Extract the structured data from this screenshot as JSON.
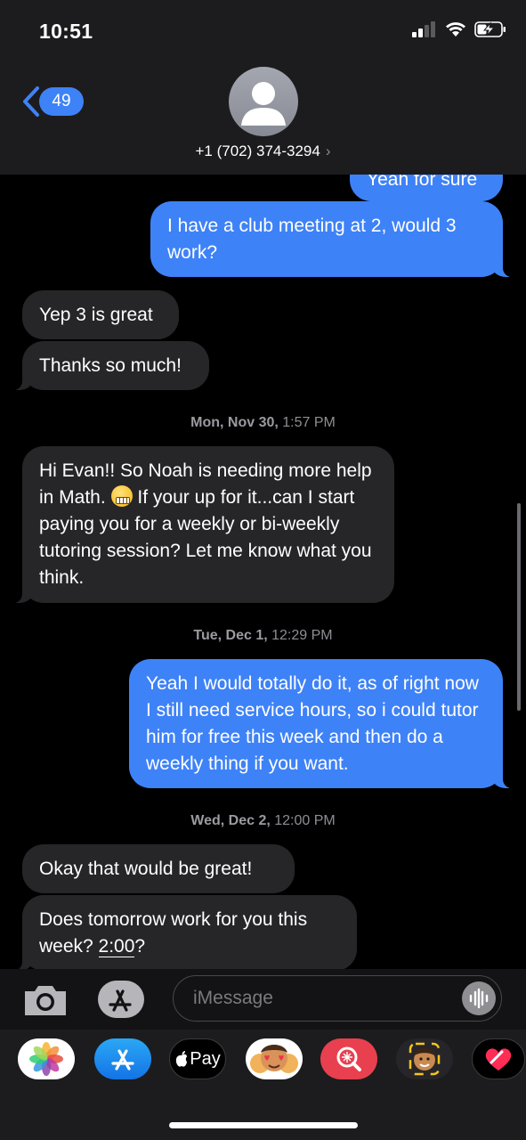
{
  "status_bar": {
    "time": "10:51"
  },
  "header": {
    "back_count": "49",
    "contact": "+1 (702) 374-3294",
    "contact_chevron": "›"
  },
  "messages": [
    {
      "dir": "out",
      "text": "Yeah for sure"
    },
    {
      "dir": "out",
      "text": "I have a club meeting at 2, would 3 work?"
    },
    {
      "dir": "in",
      "text": "Yep 3 is great"
    },
    {
      "dir": "in",
      "text": "Thanks so much!"
    },
    {
      "type": "timestamp",
      "day": "Mon, Nov 30,",
      "time": "1:57 PM"
    },
    {
      "dir": "in",
      "text_a": "Hi Evan!! So Noah is needing more help in Math.",
      "emoji": "grimacing-face",
      "text_b": "If your up for it...can I start paying you for a weekly or bi-weekly tutoring session? Let me know what you think."
    },
    {
      "type": "timestamp",
      "day": "Tue, Dec 1,",
      "time": "12:29 PM"
    },
    {
      "dir": "out",
      "text": "Yeah I would totally do it, as of right now I still need service hours, so i could tutor him for free this week and then do a weekly thing if you want."
    },
    {
      "type": "timestamp",
      "day": "Wed, Dec 2,",
      "time": "12:00 PM"
    },
    {
      "dir": "in",
      "text": "Okay that would be great!"
    },
    {
      "dir": "in",
      "text_a": "Does tomorrow work for you this week?",
      "link": "2:00",
      "text_b": "?"
    }
  ],
  "input": {
    "placeholder": "iMessage"
  },
  "app_drawer": {
    "apps": [
      "photos-icon",
      "app-store-icon",
      "apple-pay-icon",
      "memoji-stickers-icon",
      "search-images-icon",
      "memoji-icon",
      "heart-icon"
    ],
    "apple_pay_label": "Pay"
  },
  "colors": {
    "outgoing": "#3e82f7",
    "incoming": "#262628",
    "header": "#1c1c1e"
  }
}
